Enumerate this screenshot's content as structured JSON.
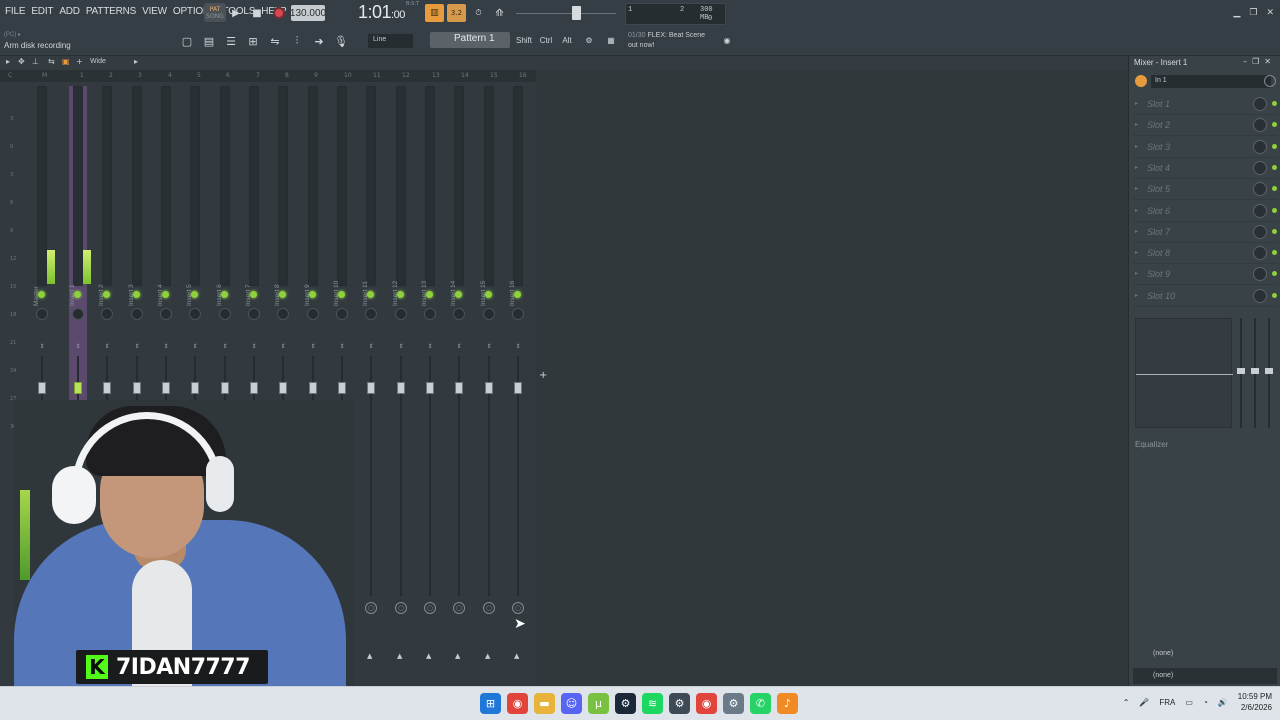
{
  "menu": [
    "FILE",
    "EDIT",
    "ADD",
    "PATTERNS",
    "VIEW",
    "OPTIONS",
    "TOOLS",
    "HELP"
  ],
  "hint": {
    "prefix": "(PC) ▸",
    "text": "Arm disk recording"
  },
  "transport": {
    "mode_top": "PAT",
    "mode_bottom": "SONG",
    "tempo": "130.000",
    "time": "1:01",
    "time_sub": ":00",
    "time_sup": "B:S:T",
    "snap": "3.2"
  },
  "cpu": {
    "voices": "1",
    "cpu": "2",
    "ram": "300 MB",
    "poly": "0"
  },
  "toolbar2": {
    "line_mode": "Line",
    "pattern": "Pattern 1",
    "shift": "Shift",
    "ctrl": "Ctrl",
    "alt": "Alt"
  },
  "news": {
    "count": "01/30",
    "line1": "FLEX: Beat Scene",
    "line2": "out now!"
  },
  "mixer_toolbar": {
    "view": "Wide"
  },
  "ruler": [
    "C",
    "M",
    "1",
    "2",
    "3",
    "4",
    "5",
    "6",
    "7",
    "8",
    "9",
    "10",
    "11",
    "12",
    "13",
    "14",
    "15",
    "16"
  ],
  "db_scale": [
    "3",
    "0",
    "3",
    "6",
    "9",
    "12",
    "15",
    "18",
    "21",
    "24",
    "27",
    "30"
  ],
  "tracks": [
    "Master",
    "Insert 1",
    "Insert 2",
    "Insert 3",
    "Insert 4",
    "Insert 5",
    "Insert 6",
    "Insert 7",
    "Insert 8",
    "Insert 9",
    "Insert 10",
    "Insert 11",
    "Insert 12",
    "Insert 13",
    "Insert 14",
    "Insert 15",
    "Insert 16"
  ],
  "selected_track": "Insert 1",
  "right_panel": {
    "title": "Mixer - Insert 1",
    "input": "In 1",
    "slots": [
      "Slot 1",
      "Slot 2",
      "Slot 3",
      "Slot 4",
      "Slot 5",
      "Slot 6",
      "Slot 7",
      "Slot 8",
      "Slot 9",
      "Slot 10"
    ],
    "eq_label": "Equalizer",
    "send1": "(none)",
    "send2": "(none)"
  },
  "streamer": {
    "logo": "K",
    "name": "7IDAN7777"
  },
  "taskbar": {
    "icons": [
      "windows-icon",
      "chrome-icon",
      "folder-icon",
      "discord-icon",
      "utorrent-icon",
      "steam-icon",
      "spotify-icon",
      "settings-icon",
      "chrome-icon",
      "gear-icon",
      "whatsapp-icon",
      "fl-studio-icon"
    ],
    "lang": "FRA",
    "time": "10:59 PM",
    "date": "2/6/2026"
  },
  "colors": {
    "accent_green": "#8ed13d",
    "selected_track": "#7d5596",
    "record": "#d7474f",
    "snap": "#e89b3c",
    "kick": "#53fc18"
  }
}
